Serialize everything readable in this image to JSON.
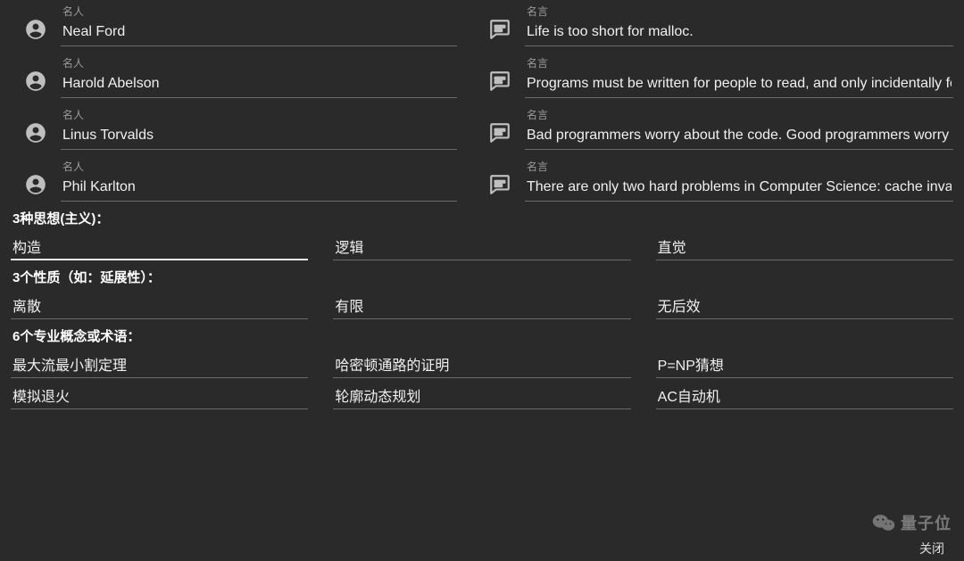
{
  "labels": {
    "person": "名人",
    "quote": "名言"
  },
  "pairs": [
    {
      "person": "Neal Ford",
      "quote": "Life is too short for malloc."
    },
    {
      "person": "Harold Abelson",
      "quote": "Programs must be written for people to read, and only incidentally fo"
    },
    {
      "person": "Linus Torvalds",
      "quote": "Bad programmers worry about the code. Good programmers worry a"
    },
    {
      "person": "Phil Karlton",
      "quote": "There are only two hard problems in Computer Science: cache invali"
    }
  ],
  "sections": {
    "thoughts": {
      "title": "3种思想(主义)：",
      "items": [
        "构造",
        "逻辑",
        "直觉"
      ],
      "focused_index": 0
    },
    "properties": {
      "title": "3个性质（如：延展性）：",
      "items": [
        "离散",
        "有限",
        "无后效"
      ]
    },
    "concepts": {
      "title": "6个专业概念或术语：",
      "rows": [
        [
          "最大流最小割定理",
          "哈密顿通路的证明",
          "P=NP猜想"
        ],
        [
          "模拟退火",
          "轮廓动态规划",
          "AC自动机"
        ]
      ]
    }
  },
  "watermark": "量子位",
  "close_label": "关闭"
}
